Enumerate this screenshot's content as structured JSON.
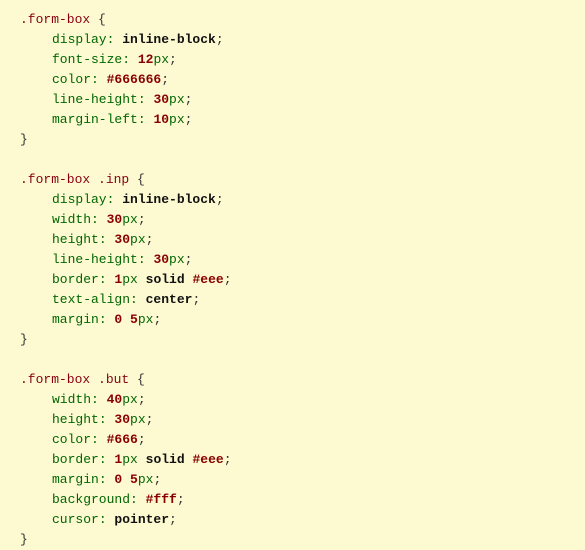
{
  "language": "css",
  "rules": [
    {
      "selector": ".form-box",
      "declarations": [
        {
          "property": "display",
          "tokens": [
            {
              "t": "kw",
              "v": "inline-block"
            }
          ]
        },
        {
          "property": "font-size",
          "tokens": [
            {
              "t": "num",
              "v": "12"
            },
            {
              "t": "unit",
              "v": "px"
            }
          ]
        },
        {
          "property": "color",
          "tokens": [
            {
              "t": "hex",
              "v": "#666666"
            }
          ]
        },
        {
          "property": "line-height",
          "tokens": [
            {
              "t": "num",
              "v": "30"
            },
            {
              "t": "unit",
              "v": "px"
            }
          ]
        },
        {
          "property": "margin-left",
          "tokens": [
            {
              "t": "num",
              "v": "10"
            },
            {
              "t": "unit",
              "v": "px"
            }
          ]
        }
      ]
    },
    {
      "selector": ".form-box .inp",
      "declarations": [
        {
          "property": "display",
          "tokens": [
            {
              "t": "kw",
              "v": "inline-block"
            }
          ]
        },
        {
          "property": "width",
          "tokens": [
            {
              "t": "num",
              "v": "30"
            },
            {
              "t": "unit",
              "v": "px"
            }
          ]
        },
        {
          "property": "height",
          "tokens": [
            {
              "t": "num",
              "v": "30"
            },
            {
              "t": "unit",
              "v": "px"
            }
          ]
        },
        {
          "property": "line-height",
          "tokens": [
            {
              "t": "num",
              "v": "30"
            },
            {
              "t": "unit",
              "v": "px"
            }
          ]
        },
        {
          "property": "border",
          "tokens": [
            {
              "t": "num",
              "v": "1"
            },
            {
              "t": "unit",
              "v": "px"
            },
            {
              "t": "sp",
              "v": " "
            },
            {
              "t": "kw",
              "v": "solid"
            },
            {
              "t": "sp",
              "v": " "
            },
            {
              "t": "hex",
              "v": "#eee"
            }
          ]
        },
        {
          "property": "text-align",
          "tokens": [
            {
              "t": "kw",
              "v": "center"
            }
          ]
        },
        {
          "property": "margin",
          "tokens": [
            {
              "t": "num",
              "v": "0"
            },
            {
              "t": "sp",
              "v": " "
            },
            {
              "t": "num",
              "v": "5"
            },
            {
              "t": "unit",
              "v": "px"
            }
          ]
        }
      ]
    },
    {
      "selector": ".form-box .but",
      "declarations": [
        {
          "property": "width",
          "tokens": [
            {
              "t": "num",
              "v": "40"
            },
            {
              "t": "unit",
              "v": "px"
            }
          ]
        },
        {
          "property": "height",
          "tokens": [
            {
              "t": "num",
              "v": "30"
            },
            {
              "t": "unit",
              "v": "px"
            }
          ]
        },
        {
          "property": "color",
          "tokens": [
            {
              "t": "hex",
              "v": "#666"
            }
          ]
        },
        {
          "property": "border",
          "tokens": [
            {
              "t": "num",
              "v": "1"
            },
            {
              "t": "unit",
              "v": "px"
            },
            {
              "t": "sp",
              "v": " "
            },
            {
              "t": "kw",
              "v": "solid"
            },
            {
              "t": "sp",
              "v": " "
            },
            {
              "t": "hex",
              "v": "#eee"
            }
          ]
        },
        {
          "property": "margin",
          "tokens": [
            {
              "t": "num",
              "v": "0"
            },
            {
              "t": "sp",
              "v": " "
            },
            {
              "t": "num",
              "v": "5"
            },
            {
              "t": "unit",
              "v": "px"
            }
          ]
        },
        {
          "property": "background",
          "tokens": [
            {
              "t": "hex",
              "v": "#fff"
            }
          ]
        },
        {
          "property": "cursor",
          "tokens": [
            {
              "t": "kw",
              "v": "pointer"
            }
          ]
        }
      ]
    }
  ]
}
